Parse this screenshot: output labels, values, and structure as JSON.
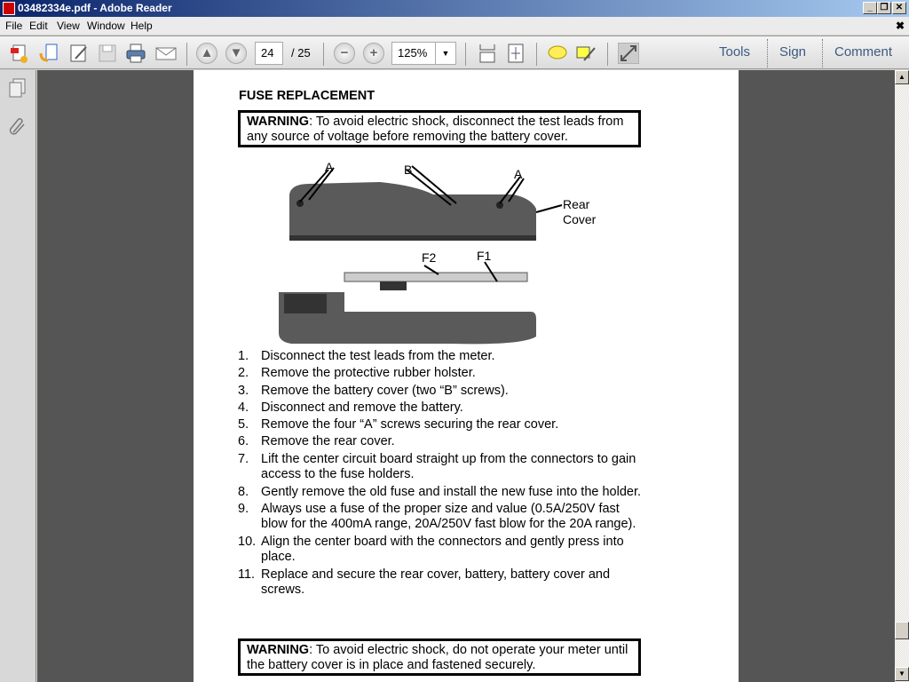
{
  "window": {
    "title": "03482334e.pdf - Adobe Reader"
  },
  "menu": [
    "File",
    "Edit",
    "View",
    "Window",
    "Help"
  ],
  "toolbar": {
    "page_current": "24",
    "page_total": "/ 25",
    "zoom": "125%",
    "tools": "Tools",
    "sign": "Sign",
    "comment": "Comment"
  },
  "document": {
    "heading": "FUSE REPLACEMENT",
    "warning1": {
      "label": "WARNING",
      "text": ": To avoid electric shock, disconnect the test leads from any source of voltage before removing the battery cover."
    },
    "figure_labels": {
      "a": "A",
      "b": "B",
      "rear": "Rear",
      "cover": "Cover",
      "f1": "F1",
      "f2": "F2"
    },
    "steps": [
      {
        "n": "1.",
        "t": "Disconnect the test leads from the meter."
      },
      {
        "n": "2.",
        "t": "Remove the protective rubber holster."
      },
      {
        "n": "3.",
        "t": "Remove the battery cover (two “B” screws)."
      },
      {
        "n": "4.",
        "t": "Disconnect and remove the battery."
      },
      {
        "n": "5.",
        "t": "Remove the four “A” screws securing the rear cover."
      },
      {
        "n": "6.",
        "t": "Remove the rear cover."
      },
      {
        "n": "7.",
        "t": "Lift the center circuit board straight up from the connectors to gain access to the fuse holders."
      },
      {
        "n": "8.",
        "t": "Gently remove the old fuse and install the new fuse into the holder."
      },
      {
        "n": "9.",
        "t": "Always use a fuse of the proper size and value (0.5A/250V fast blow for the 400mA range, 20A/250V fast blow for the 20A range)."
      },
      {
        "n": "10.",
        "t": "Align the center board with the connectors and gently press into place."
      },
      {
        "n": "11.",
        "t": "Replace and secure the rear cover, battery, battery cover and screws."
      }
    ],
    "warning2": {
      "label": "WARNING",
      "text": ": To avoid electric shock, do not operate your meter until the battery cover is in place and fastened securely."
    }
  }
}
